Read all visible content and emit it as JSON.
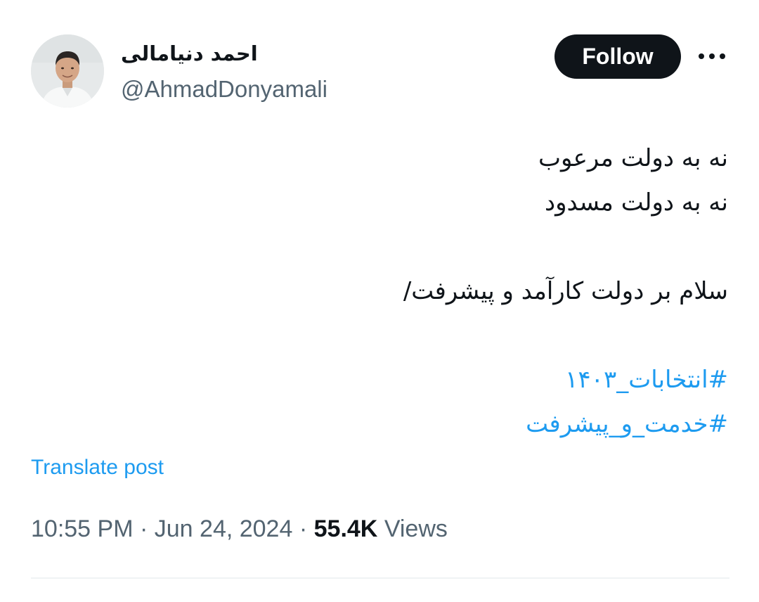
{
  "author": {
    "display_name": "احمد دنیامالی",
    "handle": "@AhmadDonyamali"
  },
  "header": {
    "follow_label": "Follow",
    "more_icon": "more-horizontal-icon"
  },
  "tweet": {
    "lines": [
      "نه به دولت مرعوب",
      "نه به دولت مسدود",
      "سلام بر دولت کارآمد و پیشرفت/"
    ],
    "hashtags": [
      "#انتخابات_۱۴۰۳",
      "#خدمت_و_پیشرفت"
    ]
  },
  "translate_label": "Translate post",
  "meta": {
    "time": "10:55 PM",
    "separator": "·",
    "date": "Jun 24, 2024",
    "views_count": "55.4K",
    "views_label": "Views"
  },
  "colors": {
    "text": "#0f1419",
    "secondary": "#536471",
    "link": "#1d9bf0",
    "button_bg": "#0f1419"
  }
}
